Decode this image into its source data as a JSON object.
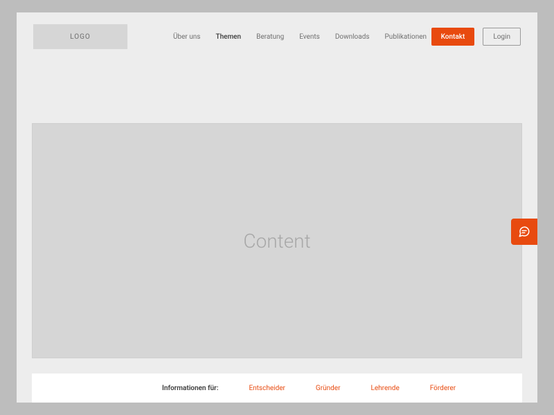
{
  "header": {
    "logo": "LOGO",
    "nav_items": [
      {
        "label": "Über uns",
        "active": false
      },
      {
        "label": "Themen",
        "active": true
      },
      {
        "label": "Beratung",
        "active": false
      },
      {
        "label": "Events",
        "active": false
      },
      {
        "label": "Downloads",
        "active": false
      },
      {
        "label": "Publikationen",
        "active": false
      }
    ],
    "contact_button": "Kontakt",
    "login_button": "Login"
  },
  "main": {
    "content_placeholder": "Content"
  },
  "info_bar": {
    "label": "Informationen für:",
    "links": [
      "Entscheider",
      "Gründer",
      "Lehrende",
      "Förderer"
    ]
  },
  "chat_tab": {
    "icon": "chat-icon"
  },
  "colors": {
    "accent": "#e84a0f",
    "page_bg": "#ededed",
    "placeholder_bg": "#d6d6d6",
    "outer_bg": "#bdbdbd"
  }
}
